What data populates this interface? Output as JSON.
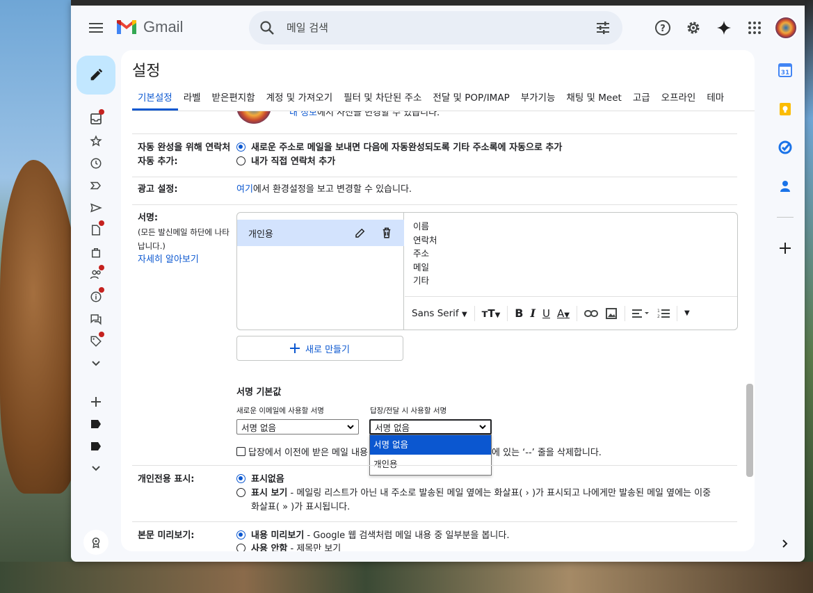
{
  "app": {
    "logo_text": "Gmail"
  },
  "search": {
    "placeholder": "메일 검색"
  },
  "settings": {
    "title": "설정",
    "tabs": [
      "기본설정",
      "라벨",
      "받은편지함",
      "계정 및 가져오기",
      "필터 및 차단된 주소",
      "전달 및 POP/IMAP",
      "부가기능",
      "채팅 및 Meet",
      "고급",
      "오프라인",
      "테마"
    ],
    "profile_note_link": "내 정보",
    "profile_note_rest": "에서 사진을 변경할 수 있습니다.",
    "autocomplete": {
      "label_line1": "자동 완성을 위해 연락처",
      "label_line2": "자동 추가:",
      "option1": "새로운 주소로 메일을 보내면 다음에 자동완성되도록 기타 주소록에 자동으로 추가",
      "option2": "내가 직접 연락처 추가"
    },
    "ads": {
      "label": "광고 설정:",
      "link": "여기",
      "text": "에서 환경설정을 보고 변경할 수 있습니다."
    },
    "signature": {
      "label": "서명:",
      "note_line1": "(모든 발신메일 하단에 나타",
      "note_line2": "납니다.)",
      "learn_more": "자세히 알아보기",
      "item_name": "개인용",
      "body_lines": [
        "이름",
        "연락처",
        "주소",
        "메일",
        "기타"
      ],
      "font_name": "Sans Serif",
      "new_button": "새로 만들기",
      "defaults_title": "서명 기본값",
      "new_email_label": "새로운 이메일에 사용할 서명",
      "reply_label": "답장/전달 시 사용할 서명",
      "new_email_value": "서명 없음",
      "reply_value": "서명 없음",
      "dropdown_options": [
        "서명 없음",
        "개인용"
      ],
      "checkbox_text_a": "답장에서 이전에 받은 메일 내용",
      "checkbox_text_b": "에 있는 ‘--’ 줄을 삭제합니다."
    },
    "personal_indicator": {
      "label": "개인전용 표시:",
      "option1": "표시없음",
      "option2_bold": "표시 보기",
      "option2_text_line1": " - 메일링 리스트가 아닌 내 주소로 발송된 메일 옆에는 화살표( › )가 표시되고 나에게만 발송된 메일 옆에는 이중",
      "option2_text_line2": "화살표( » )가 표시됩니다."
    },
    "snippets": {
      "label": "본문 미리보기:",
      "option1_bold": "내용 미리보기",
      "option1_text": " - Google 웹 검색처럼 메일 내용 중 일부분을 봅니다.",
      "option2_bold": "사용 안함",
      "option2_text": " - 제목만 보기"
    }
  },
  "side_panel": {
    "calendar_day": "31"
  },
  "colors": {
    "accent": "#0b57d0",
    "selected_bg": "#d3e3fd",
    "compose_bg": "#c2e7ff",
    "badge": "#c5221f"
  }
}
